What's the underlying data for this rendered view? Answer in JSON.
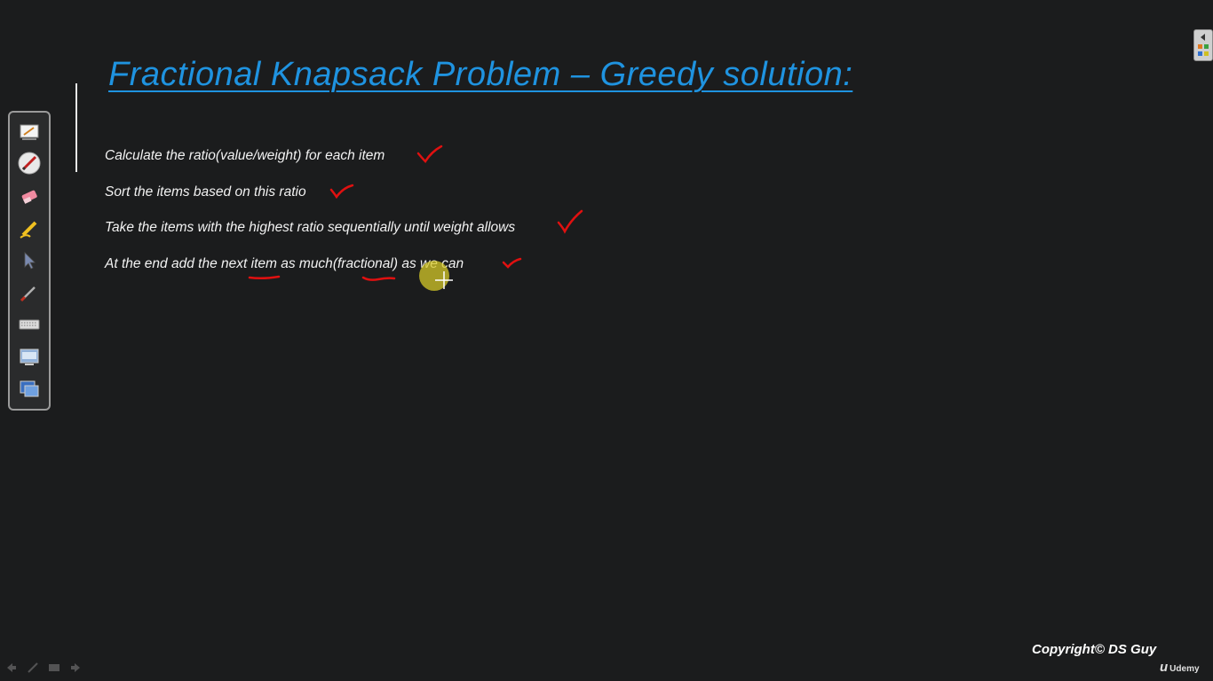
{
  "slide": {
    "title": "Fractional Knapsack Problem – Greedy solution:",
    "bullets": [
      {
        "text": "Calculate the ratio(value/weight)  for each item"
      },
      {
        "text": "Sort the items based on this ratio"
      },
      {
        "text": "Take the items with the highest ratio sequentially  until weight allows"
      },
      {
        "prefix": "At the end add the ",
        "w1": "next",
        "mid1": " ",
        "w2": "item",
        "mid2": " as much",
        "w3": "(fractional)",
        "suffix": "  as we can"
      }
    ]
  },
  "footer": {
    "copyright": "Copyright© DS Guy",
    "brand": "Udemy"
  },
  "toolbar": {
    "tools": [
      "whiteboard-icon",
      "pen-icon",
      "eraser-icon",
      "highlighter-icon",
      "pointer-icon",
      "brush-icon",
      "keyboard-icon",
      "screen-capture-icon",
      "desktop-icon"
    ]
  },
  "colors": {
    "title": "#1f93e0",
    "ink": "#e01010",
    "background": "#1b1c1d",
    "highlight": "#d6c828"
  }
}
